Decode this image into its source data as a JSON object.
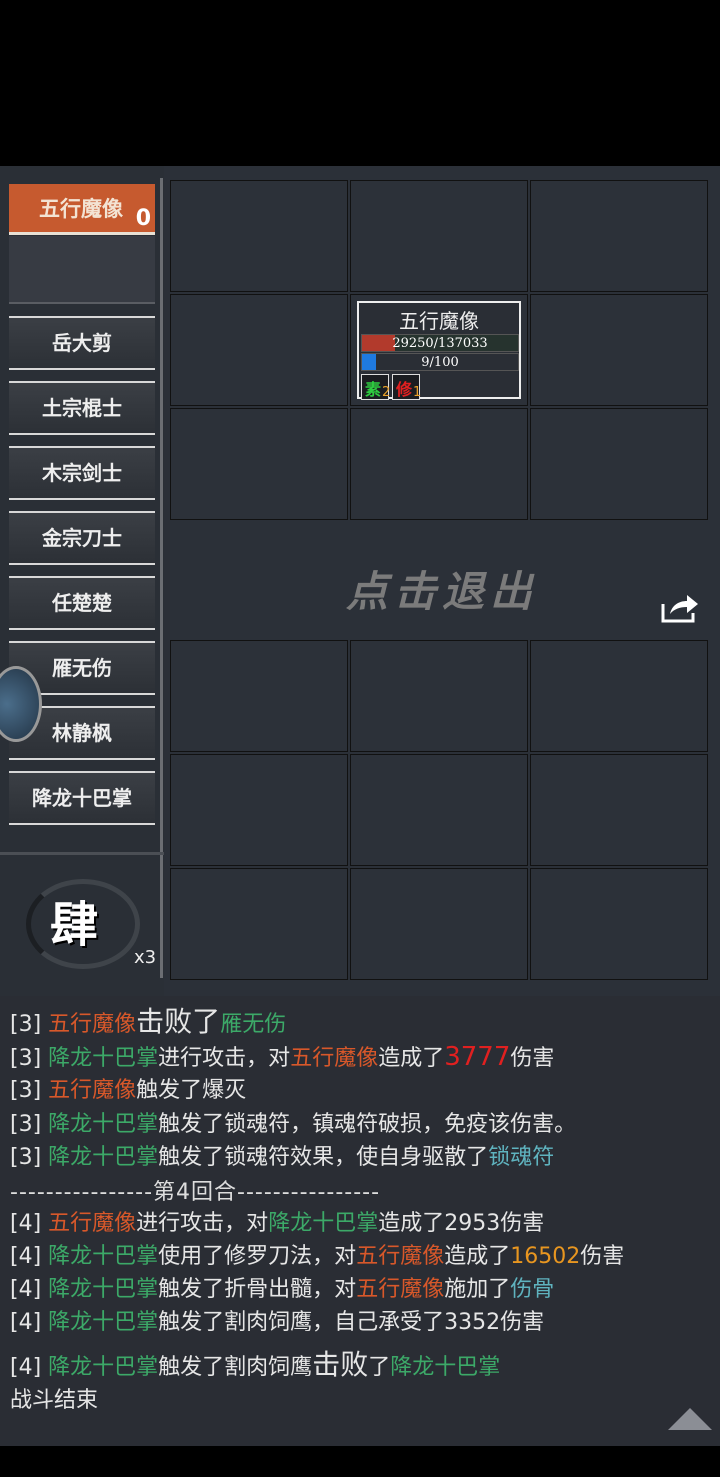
{
  "enemy_panel": {
    "name": "五行魔像",
    "count": "0"
  },
  "team": [
    "岳大剪",
    "土宗棍士",
    "木宗剑士",
    "金宗刀士",
    "任楚楚",
    "雁无伤",
    "林静枫",
    "降龙十巴掌"
  ],
  "speed": {
    "char": "肆",
    "multiplier": "x3"
  },
  "exit_label": "点击退出",
  "unit": {
    "name": "五行魔像",
    "hp_text": "29250/137033",
    "hp_fraction": 0.2134,
    "mp_text": "9/100",
    "mp_fraction": 0.09,
    "buffs": [
      {
        "glyph": "素",
        "count": "2",
        "color": "#2ecc40"
      },
      {
        "glyph": "修",
        "count": "1",
        "color": "#e02020"
      }
    ]
  },
  "log": {
    "l0": [
      "[3] ",
      "五行魔像",
      "击败了",
      "雁无伤"
    ],
    "l1": [
      "[3] ",
      "降龙十巴掌",
      "进行攻击，对",
      "五行魔像",
      "造成了",
      "3777",
      "伤害"
    ],
    "l2": [
      "[3] ",
      "五行魔像",
      "触发了爆灭"
    ],
    "l3": [
      "[3] ",
      "降龙十巴掌",
      "触发了锁魂符，镇魂符破损，免疫该伤害。"
    ],
    "l4": [
      "[3] ",
      "降龙十巴掌",
      "触发了锁魂符效果，使自身驱散了",
      "锁魂符"
    ],
    "sep": "----------------第4回合----------------",
    "l5": [
      "[4] ",
      "五行魔像",
      "进行攻击，对",
      "降龙十巴掌",
      "造成了2953伤害"
    ],
    "l6": [
      "[4] ",
      "降龙十巴掌",
      "使用了修罗刀法，对",
      "五行魔像",
      "造成了",
      "16502",
      "伤害"
    ],
    "l7": [
      "[4] ",
      "降龙十巴掌",
      "触发了折骨出髓，对",
      "五行魔像",
      "施加了",
      "伤骨"
    ],
    "l8": [
      "[4] ",
      "降龙十巴掌",
      "触发了割肉饲鹰，自己承受了3352伤害"
    ],
    "l9": [
      "[4] ",
      "降龙十巴掌",
      "触发了割肉饲鹰",
      "击败",
      "了",
      "降龙十巴掌"
    ],
    "end": "战斗结束"
  }
}
